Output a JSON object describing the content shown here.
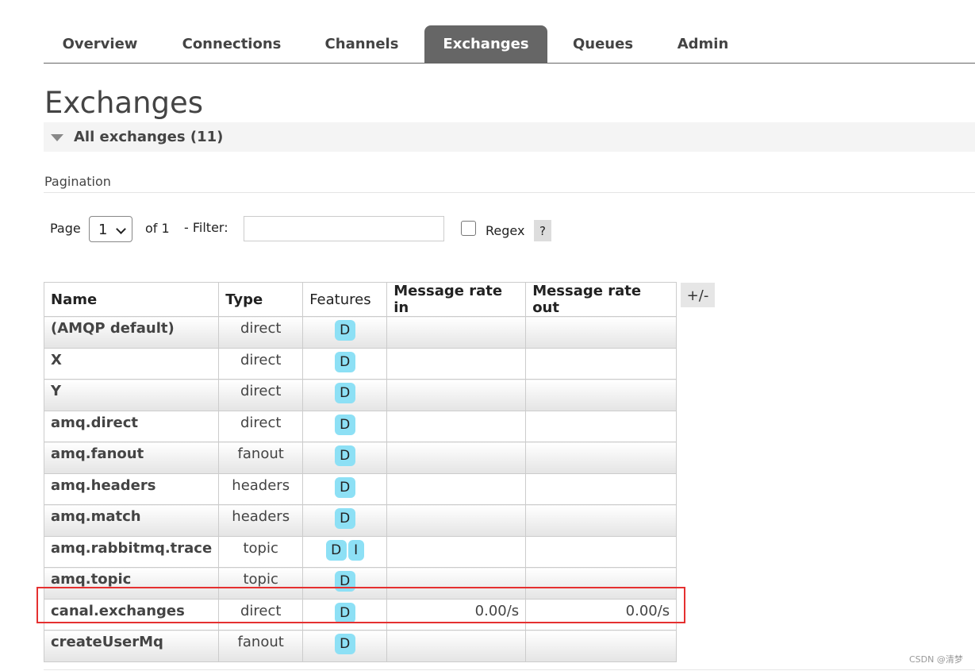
{
  "tabs": [
    "Overview",
    "Connections",
    "Channels",
    "Exchanges",
    "Queues",
    "Admin"
  ],
  "active_tab": "Exchanges",
  "page_title": "Exchanges",
  "section": {
    "label": "All exchanges (11)"
  },
  "pagination": {
    "title": "Pagination",
    "page_label": "Page",
    "page_value": "1",
    "of_label": "of 1",
    "filter_label": "- Filter:",
    "filter_value": "",
    "regex_label": "Regex",
    "regex_checked": false,
    "help_label": "?"
  },
  "table": {
    "headers": [
      "Name",
      "Type",
      "Features",
      "Message rate in",
      "Message rate out"
    ],
    "toggle_label": "+/-",
    "rows": [
      {
        "name": "(AMQP default)",
        "type": "direct",
        "features": [
          "D"
        ],
        "rate_in": "",
        "rate_out": ""
      },
      {
        "name": "X",
        "type": "direct",
        "features": [
          "D"
        ],
        "rate_in": "",
        "rate_out": ""
      },
      {
        "name": "Y",
        "type": "direct",
        "features": [
          "D"
        ],
        "rate_in": "",
        "rate_out": ""
      },
      {
        "name": "amq.direct",
        "type": "direct",
        "features": [
          "D"
        ],
        "rate_in": "",
        "rate_out": ""
      },
      {
        "name": "amq.fanout",
        "type": "fanout",
        "features": [
          "D"
        ],
        "rate_in": "",
        "rate_out": ""
      },
      {
        "name": "amq.headers",
        "type": "headers",
        "features": [
          "D"
        ],
        "rate_in": "",
        "rate_out": ""
      },
      {
        "name": "amq.match",
        "type": "headers",
        "features": [
          "D"
        ],
        "rate_in": "",
        "rate_out": ""
      },
      {
        "name": "amq.rabbitmq.trace",
        "type": "topic",
        "features": [
          "D",
          "I"
        ],
        "rate_in": "",
        "rate_out": ""
      },
      {
        "name": "amq.topic",
        "type": "topic",
        "features": [
          "D"
        ],
        "rate_in": "",
        "rate_out": ""
      },
      {
        "name": "canal.exchanges",
        "type": "direct",
        "features": [
          "D"
        ],
        "rate_in": "0.00/s",
        "rate_out": "0.00/s"
      },
      {
        "name": "createUserMq",
        "type": "fanout",
        "features": [
          "D"
        ],
        "rate_in": "",
        "rate_out": ""
      }
    ]
  },
  "colors": {
    "tab_active": "#666666",
    "badge": "#8de0f5",
    "highlight": "#e53030"
  },
  "watermark": "CSDN @清梦"
}
